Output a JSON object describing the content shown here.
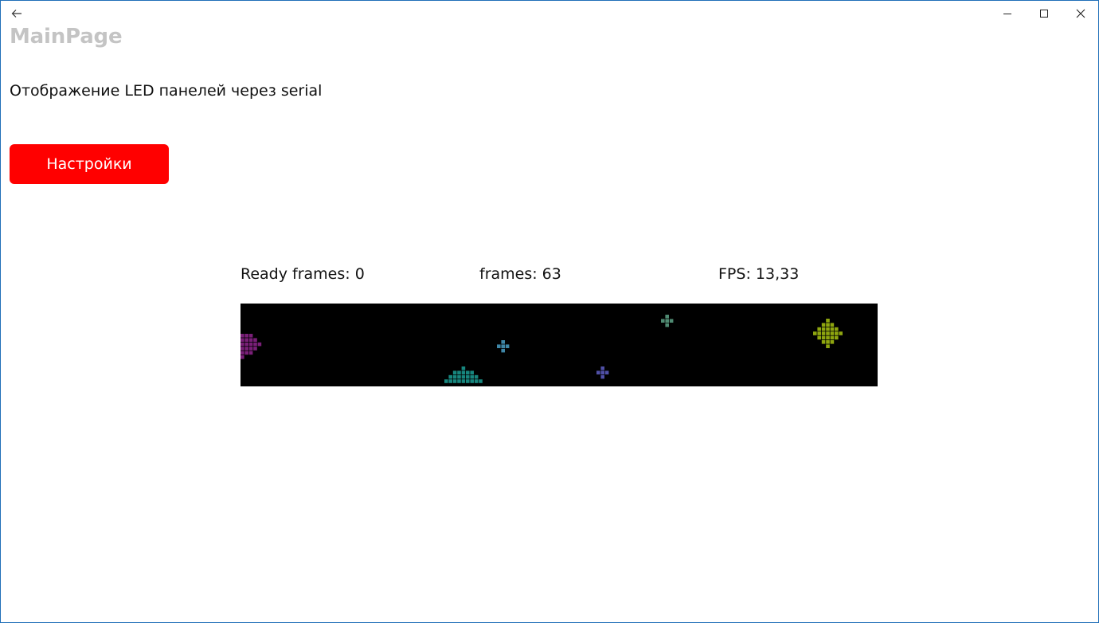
{
  "window": {
    "back_icon": "arrow-left-icon",
    "minimize_icon": "minimize-icon",
    "maximize_icon": "maximize-icon",
    "close_icon": "close-icon"
  },
  "page": {
    "title": "MainPage",
    "subtitle": "Отображение LED панелей через serial",
    "settings_button": "Настройки"
  },
  "stats": {
    "ready_frames": "Ready frames: 0",
    "frames": "frames: 63",
    "fps": "FPS: 13,33"
  },
  "led_panel": {
    "background": "#000000",
    "blobs": [
      {
        "name": "led-blob-purple",
        "color": "#7a1f78"
      },
      {
        "name": "led-blob-teal",
        "color": "#17867e"
      },
      {
        "name": "led-blob-steelblue",
        "color": "#3e86a6"
      },
      {
        "name": "led-blob-indigo",
        "color": "#5050a6"
      },
      {
        "name": "led-blob-sage",
        "color": "#4f8a72"
      },
      {
        "name": "led-blob-olive",
        "color": "#8ea50f"
      }
    ]
  }
}
